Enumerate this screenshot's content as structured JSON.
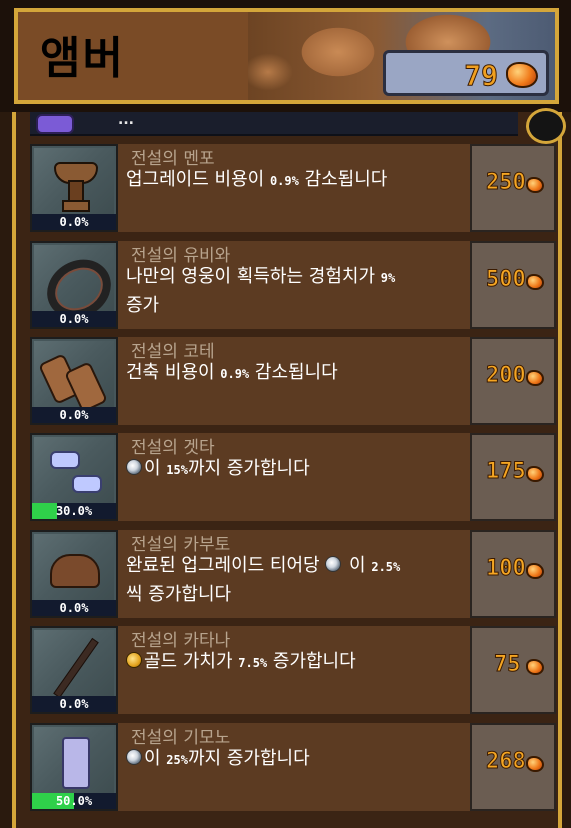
{
  "header": {
    "title": "앰버",
    "currency_value": "79"
  },
  "partial_row": {
    "text": "..."
  },
  "items": [
    {
      "name": "전설의 멘포",
      "desc_pre": "업그레이드 비용이 ",
      "desc_num": "0.9%",
      "desc_post": " 감소됩니다",
      "percent_label": "0.0%",
      "progress": 0,
      "cost": "250",
      "icon": "menpo-mask-icon"
    },
    {
      "name": "전설의 유비와",
      "desc_pre": "나만의 영웅이 획득하는 경험치가 ",
      "desc_num": "9%",
      "desc_post": " 증가",
      "percent_label": "0.0%",
      "progress": 0,
      "cost": "500",
      "icon": "ring-icon"
    },
    {
      "name": "전설의 코테",
      "desc_pre": "건축 비용이 ",
      "desc_num": "0.9%",
      "desc_post": " 감소됩니다",
      "percent_label": "0.0%",
      "progress": 0,
      "cost": "200",
      "icon": "kote-gauntlets-icon"
    },
    {
      "name": "전설의 겟타",
      "desc_pre": "이 ",
      "desc_num": "15%",
      "desc_post": "까지 증가합니다",
      "percent_label": "30.0%",
      "progress": 0.3,
      "cost": "175",
      "icon": "geta-sandals-icon"
    },
    {
      "name": "전설의 카부토",
      "desc_pre": "완료된 업그레이드 티어당 ",
      "desc_mid": " 이 ",
      "desc_num": "2.5%",
      "desc_post": " 씩 증가합니다",
      "percent_label": "0.0%",
      "progress": 0,
      "cost": "100",
      "icon": "kabuto-helmet-icon"
    },
    {
      "name": "전설의 카타나",
      "desc_pre": "골드 가치가 ",
      "desc_num": "7.5%",
      "desc_post": " 증가합니다",
      "percent_label": "0.0%",
      "progress": 0,
      "cost": "75",
      "icon": "katana-icon"
    },
    {
      "name": "전설의 기모노",
      "desc_pre": "이 ",
      "desc_num": "25%",
      "desc_post": "까지 증가합니다",
      "percent_label": "50.0%",
      "progress": 0.5,
      "cost": "268",
      "icon": "kimono-icon"
    }
  ]
}
